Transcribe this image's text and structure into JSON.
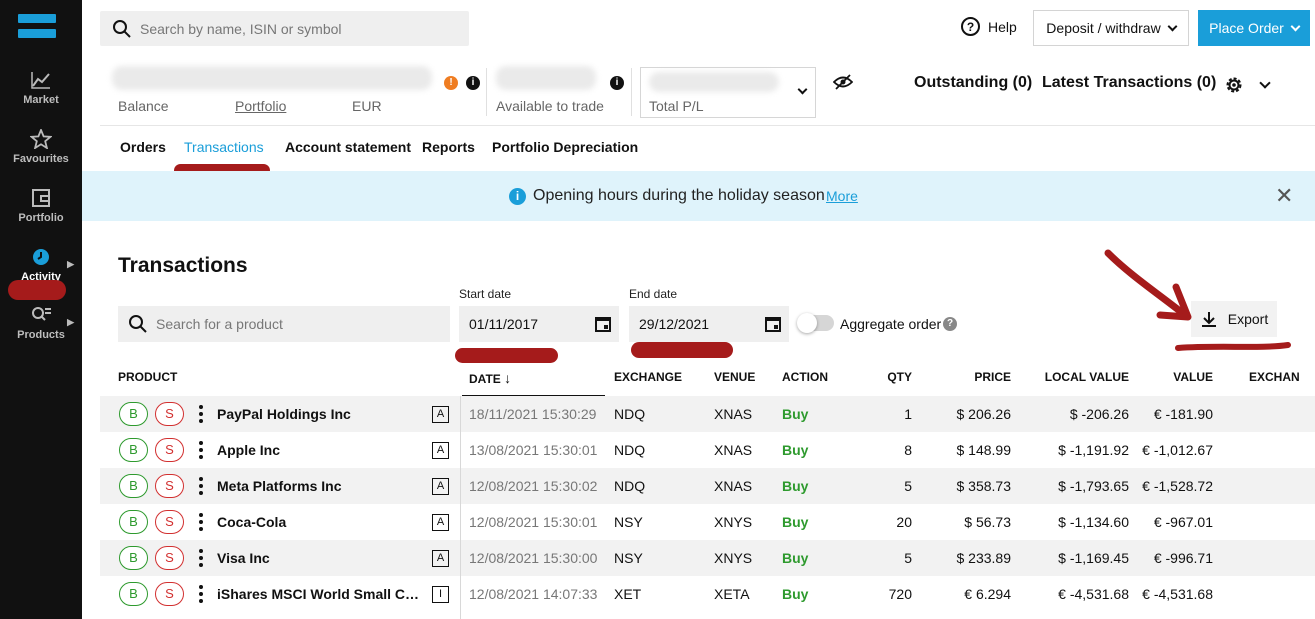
{
  "sidebar": {
    "items": [
      {
        "label": "Market",
        "icon": "chart-icon"
      },
      {
        "label": "Favourites",
        "icon": "star-icon"
      },
      {
        "label": "Portfolio",
        "icon": "wallet-icon"
      },
      {
        "label": "Activity",
        "icon": "clock-icon",
        "active": true
      },
      {
        "label": "Products",
        "icon": "search-list-icon"
      }
    ]
  },
  "header": {
    "search_placeholder": "Search by name, ISIN or symbol",
    "help": "Help",
    "deposit": "Deposit / withdraw",
    "place_order": "Place Order"
  },
  "account": {
    "balance_label": "Balance",
    "portfolio_label": "Portfolio",
    "currency": "EUR",
    "warning_mark": "!",
    "info_mark": "i",
    "available_label": "Available to trade",
    "total_pl_label": "Total P/L",
    "outstanding": "Outstanding (0)",
    "latest_transactions": "Latest Transactions (0)"
  },
  "tabs": [
    "Orders",
    "Transactions",
    "Account statement",
    "Reports",
    "Portfolio Depreciation"
  ],
  "banner": {
    "icon_mark": "i",
    "message": "Opening hours during the holiday season",
    "link": "More",
    "close": "✕"
  },
  "transactions": {
    "title": "Transactions",
    "search_placeholder": "Search for a product",
    "start_date_label": "Start date",
    "start_date": "01/11/2017",
    "end_date_label": "End date",
    "end_date": "29/12/2021",
    "aggregate_label": "Aggregate order",
    "aggregate_help": "?",
    "export": "Export"
  },
  "table": {
    "headers": {
      "product": "PRODUCT",
      "date": "DATE",
      "exchange": "EXCHANGE",
      "venue": "VENUE",
      "action": "ACTION",
      "qty": "QTY",
      "price": "PRICE",
      "local_value": "LOCAL VALUE",
      "value": "VALUE",
      "exchange_rate": "EXCHAN"
    },
    "buy_label": "B",
    "sell_label": "S",
    "rows": [
      {
        "name": "PayPal Holdings Inc",
        "type": "A",
        "date": "18/11/2021 15:30:29",
        "exchange": "NDQ",
        "venue": "XNAS",
        "action": "Buy",
        "qty": "1",
        "price": "$ 206.26",
        "local_value": "$ -206.26",
        "value": "€ -181.90"
      },
      {
        "name": "Apple Inc",
        "type": "A",
        "date": "13/08/2021 15:30:01",
        "exchange": "NDQ",
        "venue": "XNAS",
        "action": "Buy",
        "qty": "8",
        "price": "$ 148.99",
        "local_value": "$ -1,191.92",
        "value": "€ -1,012.67"
      },
      {
        "name": "Meta Platforms Inc",
        "type": "A",
        "date": "12/08/2021 15:30:02",
        "exchange": "NDQ",
        "venue": "XNAS",
        "action": "Buy",
        "qty": "5",
        "price": "$ 358.73",
        "local_value": "$ -1,793.65",
        "value": "€ -1,528.72"
      },
      {
        "name": "Coca-Cola",
        "type": "A",
        "date": "12/08/2021 15:30:01",
        "exchange": "NSY",
        "venue": "XNYS",
        "action": "Buy",
        "qty": "20",
        "price": "$ 56.73",
        "local_value": "$ -1,134.60",
        "value": "€ -967.01"
      },
      {
        "name": "Visa Inc",
        "type": "A",
        "date": "12/08/2021 15:30:00",
        "exchange": "NSY",
        "venue": "XNYS",
        "action": "Buy",
        "qty": "5",
        "price": "$ 233.89",
        "local_value": "$ -1,169.45",
        "value": "€ -996.71"
      },
      {
        "name": "iShares MSCI World Small Cap U...",
        "type": "I",
        "date": "12/08/2021 14:07:33",
        "exchange": "XET",
        "venue": "XETA",
        "action": "Buy",
        "qty": "720",
        "price": "€ 6.294",
        "local_value": "€ -4,531.68",
        "value": "€ -4,531.68"
      }
    ]
  },
  "colors": {
    "accent": "#1a9ed9",
    "buy": "#2e9a2e",
    "sell": "#d23030",
    "sidebar": "#111111"
  }
}
